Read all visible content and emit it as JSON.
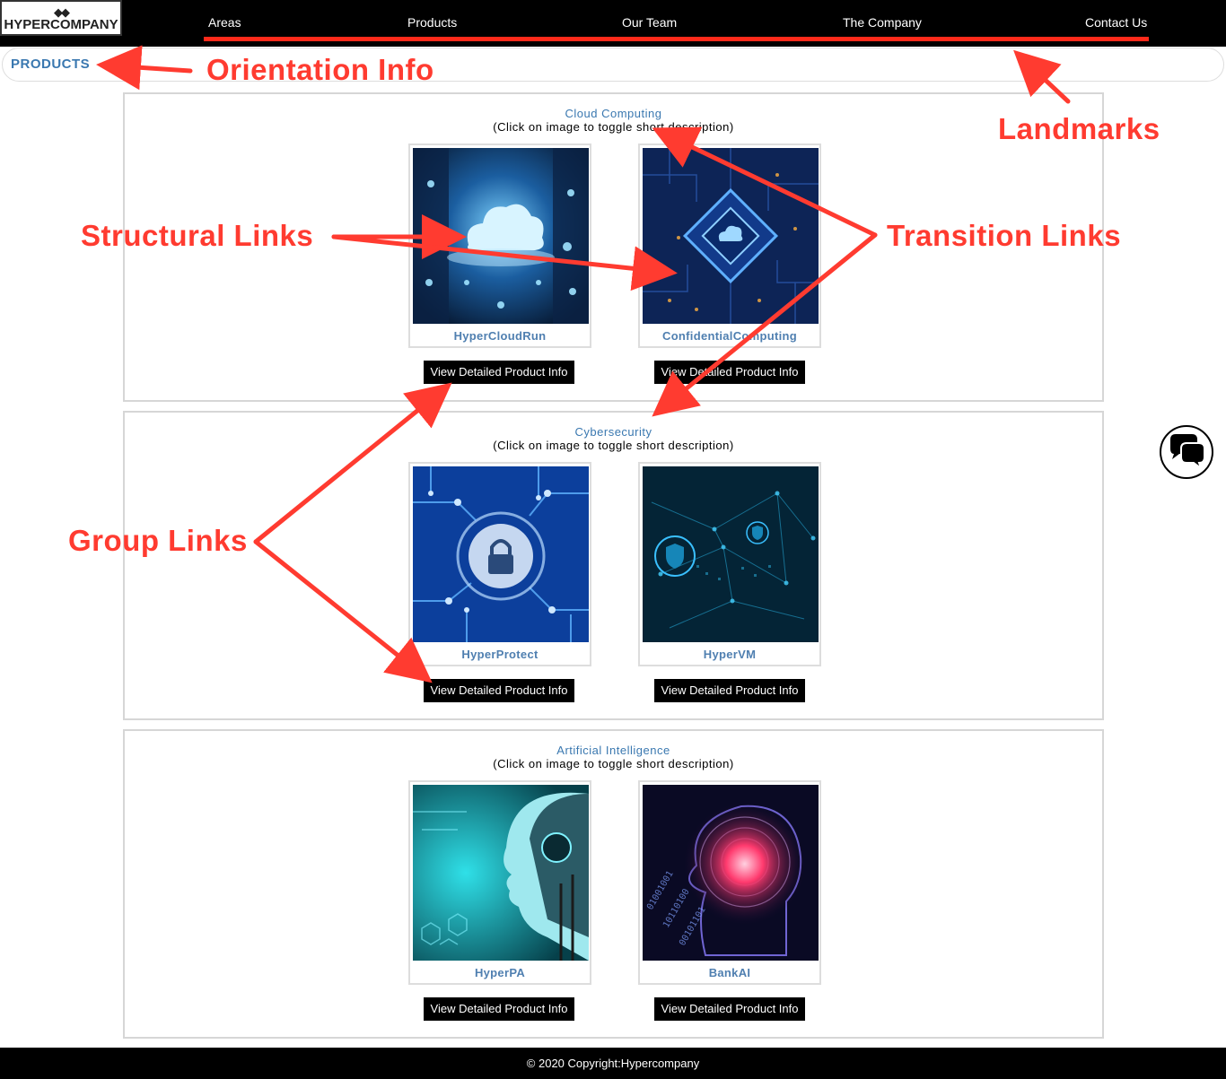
{
  "brand": {
    "logo_text": "HYPERCOMPANY",
    "logo_mark": "◆◆"
  },
  "nav": {
    "items": [
      "Areas",
      "Products",
      "Our Team",
      "The Company",
      "Contact Us"
    ]
  },
  "breadcrumb": "PRODUCTS",
  "sections": [
    {
      "title": "Cloud Computing",
      "subtitle": "(Click on image to toggle short description)",
      "products": [
        {
          "name": "HyperCloudRun",
          "button": "View Detailed Product Info",
          "image": "cloud-server-room-image"
        },
        {
          "name": "ConfidentialComputing",
          "button": "View Detailed Product Info",
          "image": "cloud-chip-image"
        }
      ]
    },
    {
      "title": "Cybersecurity",
      "subtitle": "(Click on image to toggle short description)",
      "products": [
        {
          "name": "HyperProtect",
          "button": "View Detailed Product Info",
          "image": "circuit-lock-image"
        },
        {
          "name": "HyperVM",
          "button": "View Detailed Product Info",
          "image": "network-shield-image"
        }
      ]
    },
    {
      "title": "Artificial Intelligence",
      "subtitle": "(Click on image to toggle short description)",
      "products": [
        {
          "name": "HyperPA",
          "button": "View Detailed Product Info",
          "image": "robot-head-image"
        },
        {
          "name": "BankAI",
          "button": "View Detailed Product Info",
          "image": "digital-brain-head-image"
        }
      ]
    }
  ],
  "footer": "© 2020 Copyright:Hypercompany",
  "annotations": {
    "orientation": "Orientation Info",
    "landmarks": "Landmarks",
    "structural": "Structural Links",
    "transition": "Transition Links",
    "group": "Group Links"
  },
  "colors": {
    "annotation": "#ff3b30",
    "link_blue": "#3a78b0",
    "nav_bg": "#000000",
    "underline": "#ff2a1a"
  }
}
